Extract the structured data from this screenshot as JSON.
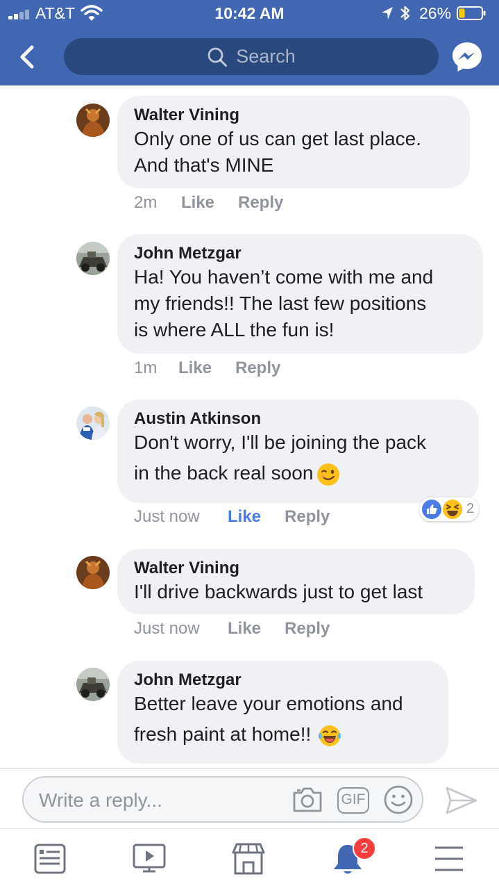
{
  "status_bar": {
    "carrier": "AT&T",
    "time": "10:42 AM",
    "battery_percent": "26%",
    "battery_level": 0.26,
    "icons": [
      "signal-icon",
      "wifi-icon",
      "location-arrow-icon",
      "bluetooth-icon",
      "battery-icon"
    ]
  },
  "nav_bar": {
    "back_icon": "chevron-left-icon",
    "search_placeholder": "Search",
    "messenger_icon": "messenger-icon"
  },
  "comments": [
    {
      "author": "Walter Vining",
      "lines": [
        "Only one of us can get last place.",
        "And that's MINE"
      ],
      "time": "2m",
      "like_label": "Like",
      "reply_label": "Reply",
      "liked": false
    },
    {
      "author": "John Metzgar",
      "lines": [
        "Ha! You haven’t come with me and",
        "my friends!! The last few positions",
        "is where ALL the fun is!"
      ],
      "time": "1m",
      "like_label": "Like",
      "reply_label": "Reply",
      "liked": false
    },
    {
      "author": "Austin Atkinson",
      "lines": [
        "Don't worry, I'll be joining the pack",
        "in the back real soon"
      ],
      "trailing_emoji": "winking-face-emoji",
      "time": "Just now",
      "like_label": "Like",
      "reply_label": "Reply",
      "liked": true,
      "reactions": {
        "types": [
          "like-reaction",
          "haha-reaction"
        ],
        "count": "2"
      }
    },
    {
      "author": "Walter Vining",
      "lines": [
        "I'll drive backwards just to get last"
      ],
      "time": "Just now",
      "like_label": "Like",
      "reply_label": "Reply",
      "liked": false
    },
    {
      "author": "John Metzgar",
      "lines": [
        "Better leave your emotions and",
        "fresh paint at home!!"
      ],
      "trailing_emoji": "tears-of-joy-emoji",
      "liked": false
    }
  ],
  "composer": {
    "placeholder": "Write a reply...",
    "gif_label": "GIF",
    "icons": [
      "camera-icon",
      "gif-icon",
      "smiley-icon",
      "send-icon"
    ]
  },
  "tab_bar": {
    "tabs": [
      "news-feed-icon",
      "video-icon",
      "marketplace-icon",
      "notifications-icon",
      "menu-icon"
    ],
    "notification_badge": "2"
  },
  "colors": {
    "header_blue": "#4267b2",
    "search_blue": "#29487d",
    "bubble_gray": "#f0f1f4",
    "liked_blue": "#4b7be5",
    "meta_gray": "#90949c",
    "badge_red": "#fa3e3e",
    "notifications_blue": "#4267b2"
  }
}
